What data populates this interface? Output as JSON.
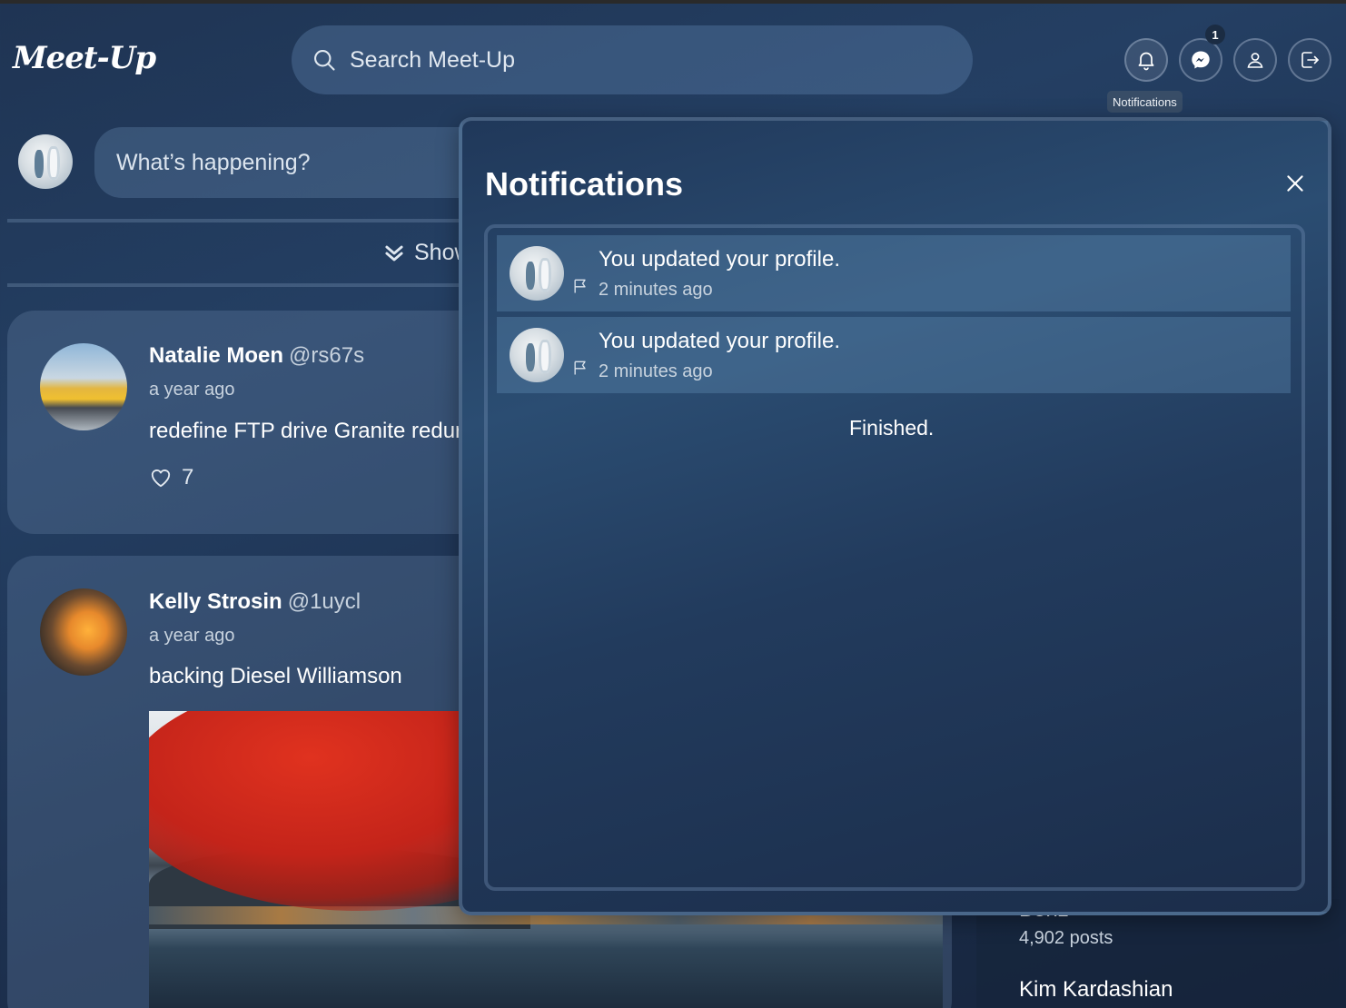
{
  "app": {
    "logo": "Meet-Up"
  },
  "search": {
    "placeholder": "Search Meet-Up"
  },
  "header": {
    "messages_badge": "1",
    "tooltip": "Notifications",
    "icons": [
      "bell-icon",
      "messenger-icon",
      "user-icon",
      "logout-icon"
    ]
  },
  "composer": {
    "placeholder": "What’s happening?"
  },
  "feed": {
    "show_label": "Show",
    "posts": [
      {
        "name": "Natalie Moen",
        "handle": "@rs67s",
        "time": "a year ago",
        "text": "redefine FTP drive Granite redur",
        "likes": "7"
      },
      {
        "name": "Kelly Strosin",
        "handle": "@1uycl",
        "time": "a year ago",
        "text": "backing Diesel Williamson"
      }
    ]
  },
  "sidebar": {
    "items": [
      {
        "name": "Benz",
        "posts": "4,902 posts"
      },
      {
        "name": "Kim Kardashian"
      }
    ]
  },
  "notifications": {
    "title": "Notifications",
    "items": [
      {
        "text": "You updated your profile.",
        "time": "2 minutes ago"
      },
      {
        "text": "You updated your profile.",
        "time": "2 minutes ago"
      }
    ],
    "end_text": "Finished."
  },
  "colors": {
    "background": "#1f3453",
    "panel": "#2b4d72",
    "text": "#ffffff",
    "muted": "#c7d2de"
  }
}
